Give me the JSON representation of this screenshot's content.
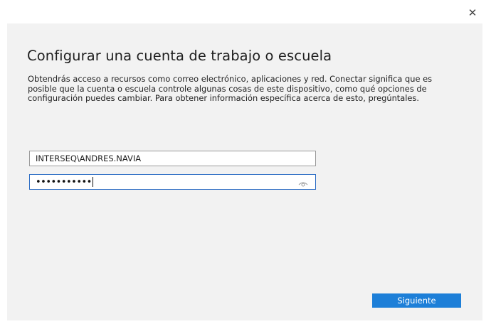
{
  "window": {
    "close_glyph": "✕"
  },
  "dialog": {
    "title": "Configurar una cuenta de trabajo o escuela",
    "description": "Obtendrás acceso a recursos como correo electrónico, aplicaciones y red. Conectar significa que es posible que la cuenta o escuela controle algunas cosas de este dispositivo, como qué opciones de configuración puedes cambiar. Para obtener información específica acerca de esto, pregúntales.",
    "username": {
      "value": "INTERSEQ\\ANDRES.NAVIA"
    },
    "password": {
      "masked_value": "•••••••••••"
    },
    "next_button_label": "Siguiente"
  },
  "colors": {
    "panel_background": "#f2f2f2",
    "accent": "#1d7fd8",
    "focus_border": "#2b6cc4"
  },
  "icons": {
    "close": "close-icon",
    "reveal_password": "eye-icon"
  }
}
